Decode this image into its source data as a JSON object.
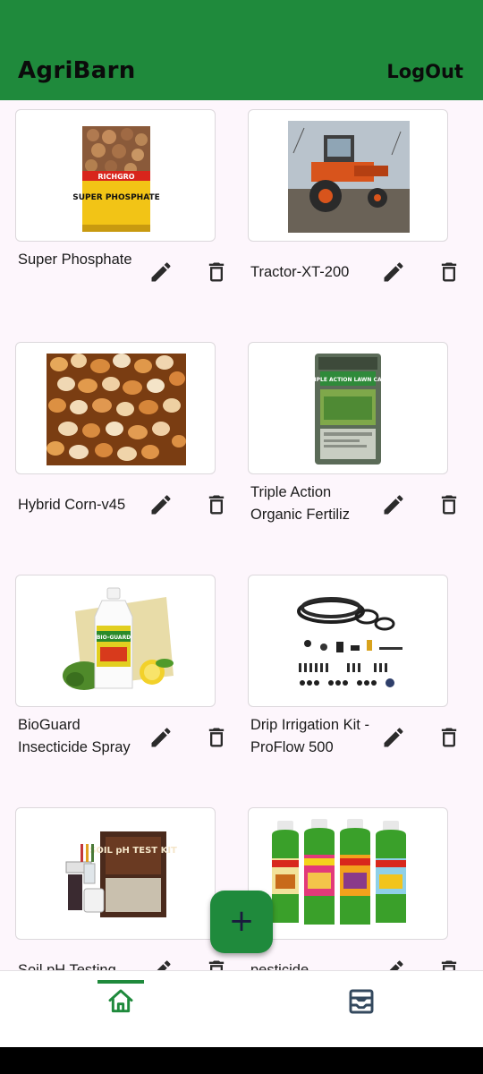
{
  "app": {
    "title": "AgriBarn",
    "logout_label": "LogOut"
  },
  "products": [
    {
      "name": "Super Phosphate"
    },
    {
      "name": "Tractor-XT-200"
    },
    {
      "name": "Hybrid Corn-v45"
    },
    {
      "name": "Triple Action Organic Fertiliz"
    },
    {
      "name": "BioGuard Insecticide Spray"
    },
    {
      "name": "Drip Irrigation Kit - ProFlow 500"
    },
    {
      "name": "Soil pH Testing"
    },
    {
      "name": "pesticide"
    }
  ],
  "product_images": {
    "p0_label": "RICHGRO",
    "p0_big": "SUPER PHOSPHATE",
    "p3_label": "TRIPLE ACTION LAWN CARE",
    "p4_label": "BIO-GUARD",
    "p6_label": "SOIL pH TEST KIT"
  },
  "fab": {
    "label": "+"
  },
  "bottom_nav": {
    "items": [
      "home-icon",
      "inventory-icon"
    ],
    "active_index": 0
  },
  "colors": {
    "primary": "#1f8a3c",
    "background": "#fdf6fc",
    "text": "#1b1b1b"
  }
}
